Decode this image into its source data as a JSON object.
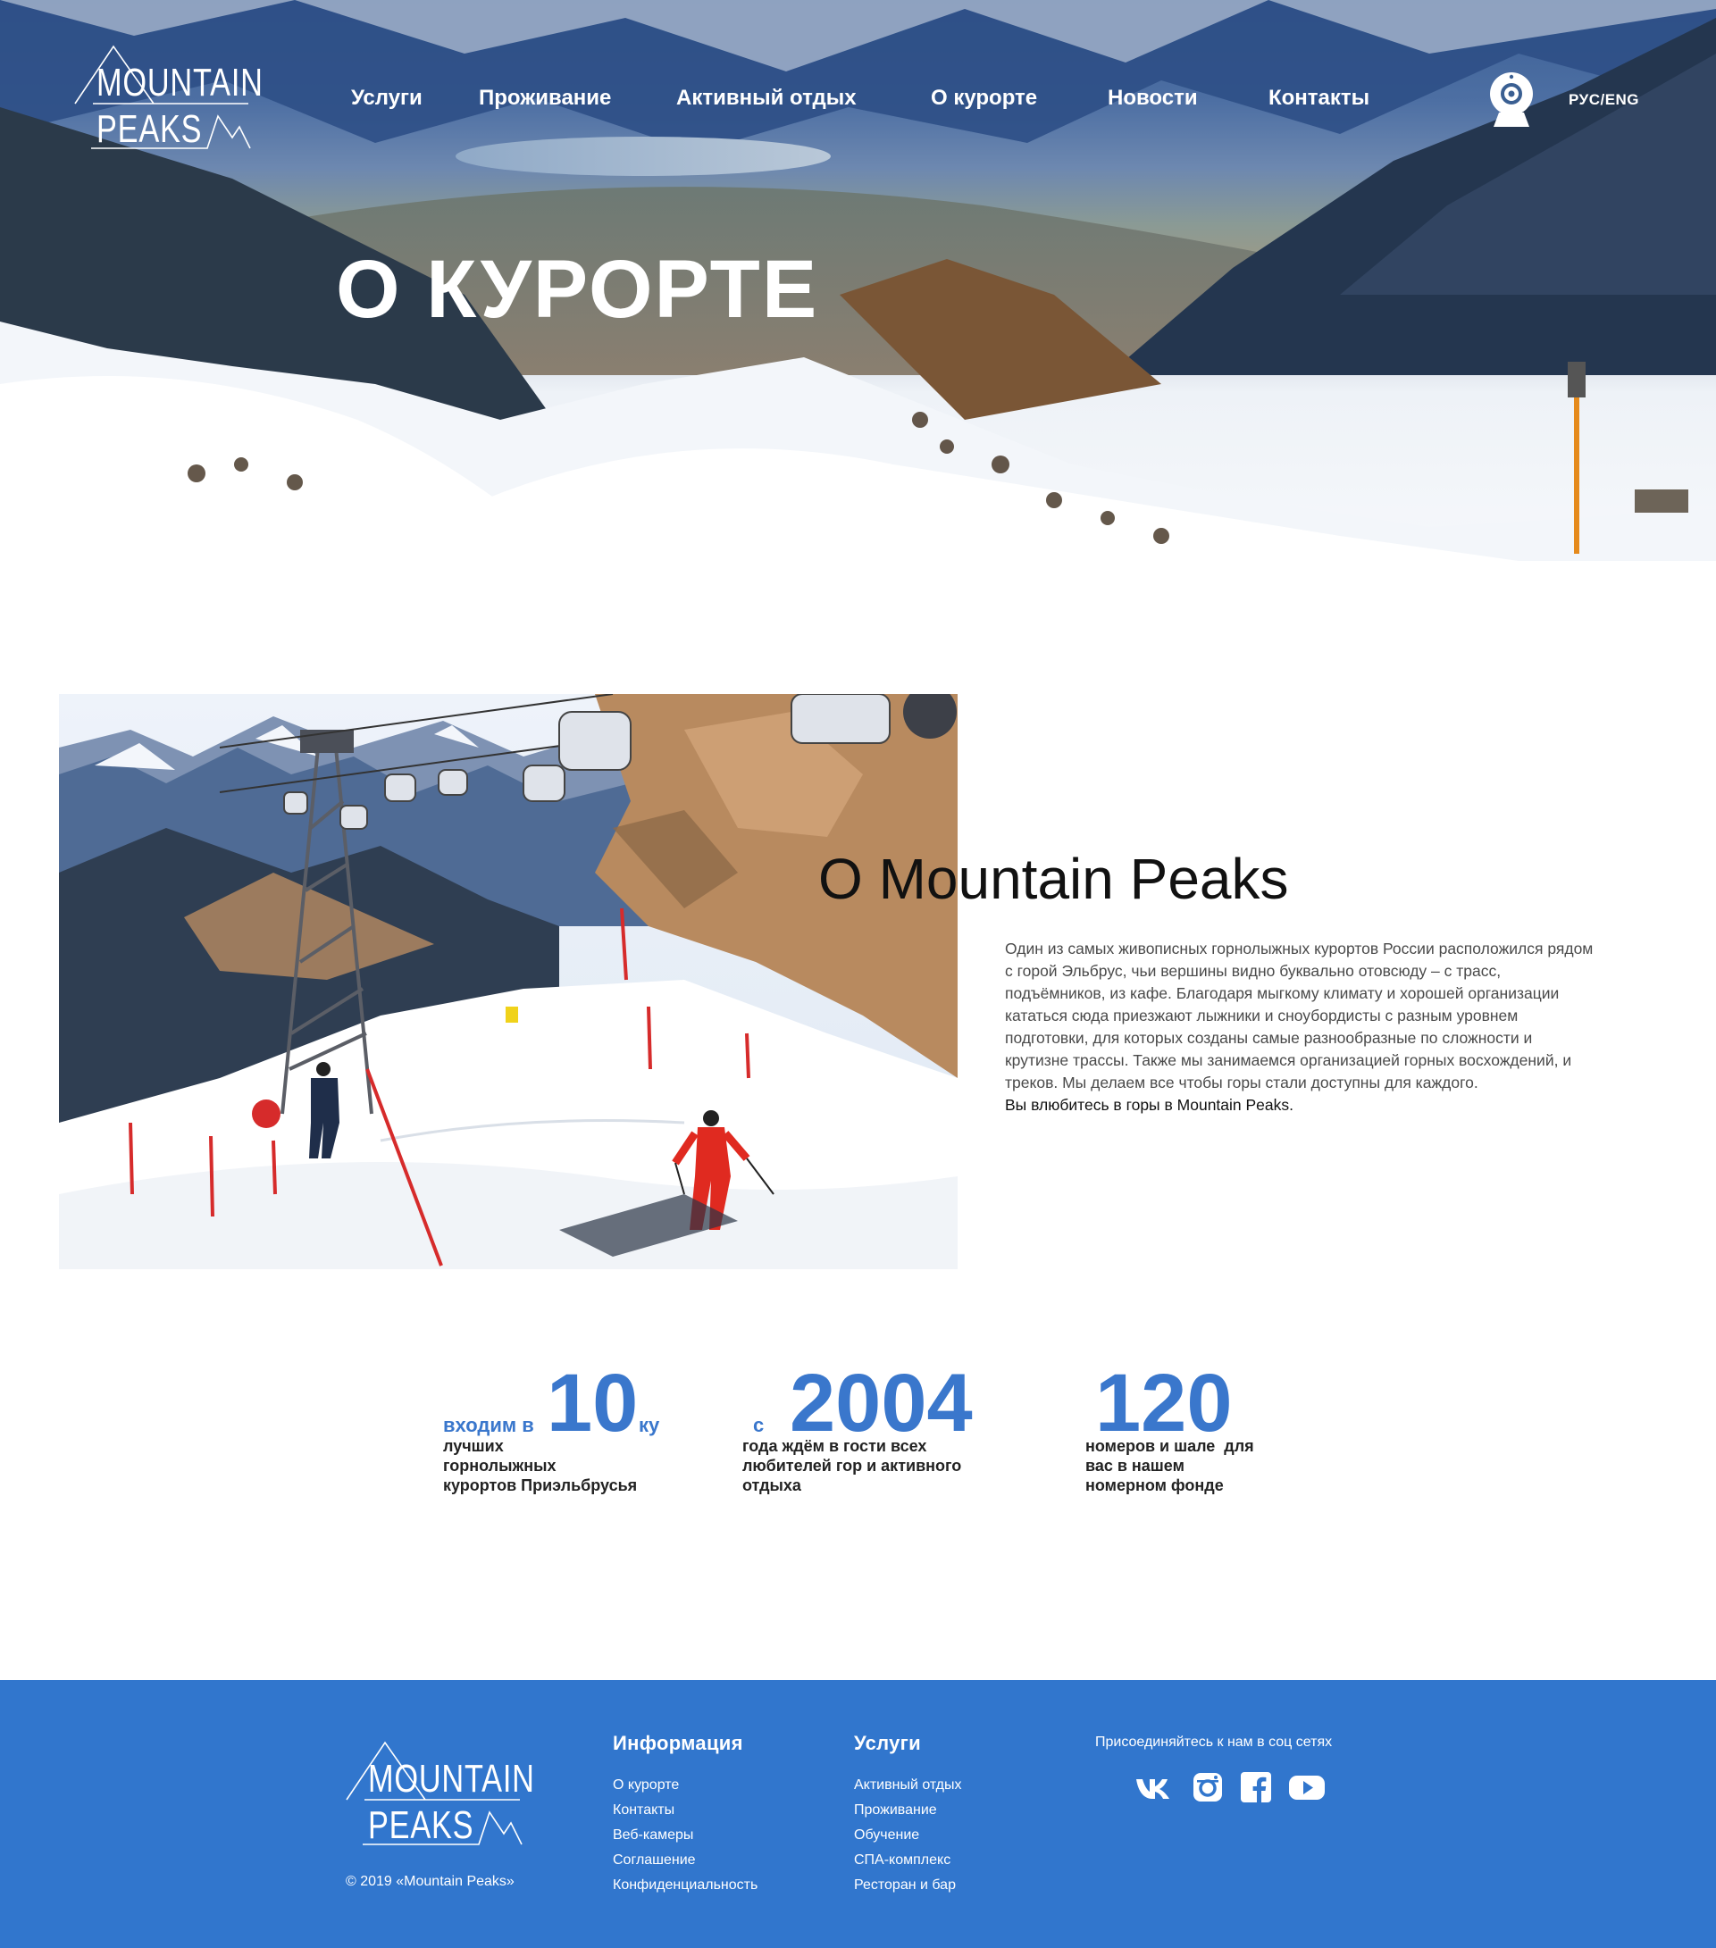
{
  "brand": {
    "line1": "MOUNTAIN",
    "line2": "PEAKS"
  },
  "nav": {
    "items": [
      {
        "label": "Услуги"
      },
      {
        "label": "Проживание"
      },
      {
        "label": "Активный отдых"
      },
      {
        "label": "О курорте"
      },
      {
        "label": "Новости"
      },
      {
        "label": "Контакты"
      }
    ],
    "webcam_icon": "webcam-icon",
    "language": "РУС/ENG"
  },
  "hero": {
    "title": "О КУРОРТЕ"
  },
  "about": {
    "title": "О Mountain Peaks",
    "text": "Один из самых живописных горнолыжных курортов России расположился рядом с горой Эльбрус, чьи вершины видно буквально отовсюду – с трасс, подъёмников, из кафе. Благодаря мыгкому климату и хорошей организации кататься сюда приезжают лыжники и сноубордисты с разным уровнем подготовки, для которых созданы самые разнообразные по сложности и крутизне трассы. Также мы занимаемся организацией горных восхождений, и треков. Мы делаем все чтобы горы стали доступны для каждого.",
    "tagline": "Вы влюбитесь в горы в Mountain Peaks."
  },
  "stats": [
    {
      "prefix": "входим в",
      "value": "10",
      "suffix": "ку",
      "desc_lines": [
        "лучших",
        "горнолыжных",
        "курортов Приэльбрусья"
      ]
    },
    {
      "prefix": "с",
      "value": "2004",
      "suffix": "",
      "desc_lines": [
        "года ждём в гости всех",
        "любителей гор и активного",
        "отдыха"
      ]
    },
    {
      "prefix": "",
      "value": "120",
      "suffix": "",
      "desc_lines": [
        "номеров и шале  для",
        "вас в нашем",
        "номерном фонде"
      ]
    }
  ],
  "footer": {
    "copyright": "© 2019 «Mountain Peaks»",
    "info": {
      "title": "Информация",
      "links": [
        "О курорте",
        "Контакты",
        "Веб-камеры",
        "Соглашение",
        "Конфиденциальность"
      ]
    },
    "services": {
      "title": "Услуги",
      "links": [
        "Активный отдых",
        "Проживание",
        "Обучение",
        "СПА-комплекс",
        "Ресторан и бар"
      ]
    },
    "social": {
      "title": "Присоединяйтесь к нам в соц сетях",
      "icons": [
        "vk-icon",
        "instagram-icon",
        "facebook-icon",
        "youtube-icon"
      ]
    }
  },
  "colors": {
    "accent": "#3176cd",
    "stat_blue": "#3a77cc",
    "text_dark": "#111111",
    "text_gray": "#4a4a4a"
  }
}
